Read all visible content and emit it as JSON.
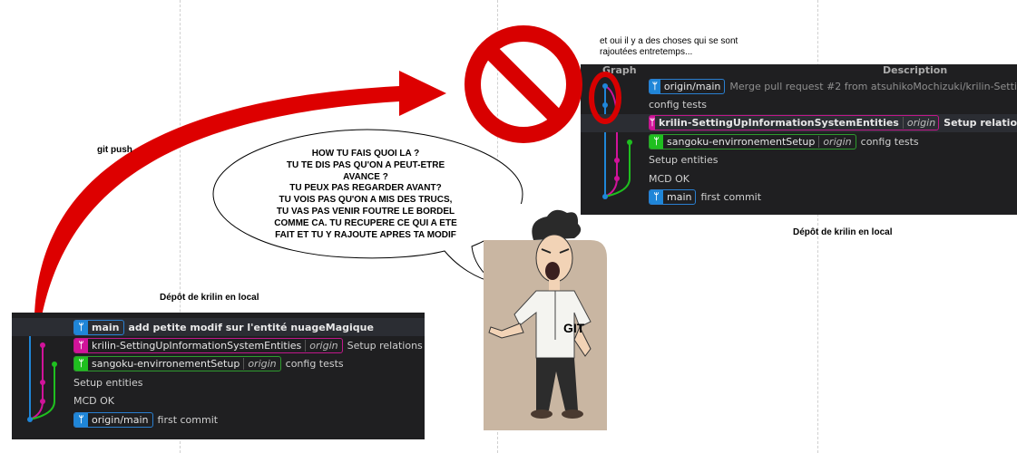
{
  "labels": {
    "git_push": "git push",
    "local_repo_left": "Dépôt de krilin en local",
    "local_repo_right": "Dépôt de krilin en local",
    "note_line1": "et oui il y a des choses qui se sont",
    "note_line2": "rajoutées entretemps...",
    "character": "GIT"
  },
  "speech": [
    "HOW TU FAIS QUOI LA ?",
    "TU TE DIS PAS QU'ON A PEUT-ETRE",
    "AVANCE ?",
    "TU PEUX PAS REGARDER AVANT?",
    "TU VOIS PAS QU'ON A MIS DES TRUCS,",
    "TU VAS PAS VENIR FOUTRE LE BORDEL",
    "COMME CA. TU RECUPERE CE QUI A ETE",
    "FAIT ET TU Y RAJOUTE APRES TA MODIF"
  ],
  "left_panel": {
    "rows": [
      {
        "badge": "main",
        "color": "blue",
        "origin": "",
        "message": "add petite modif sur l'entité nuageMagique",
        "bold": true
      },
      {
        "badge": "krilin-SettingUpInformationSystemEntities",
        "color": "pink",
        "origin": "origin",
        "message": "Setup relations",
        "bold": false
      },
      {
        "badge": "sangoku-envirronementSetup",
        "color": "green",
        "origin": "origin",
        "message": "config tests",
        "bold": false
      },
      {
        "badge": "",
        "color": "",
        "origin": "",
        "message": "Setup entities",
        "bold": false
      },
      {
        "badge": "",
        "color": "",
        "origin": "",
        "message": "MCD OK",
        "bold": false
      },
      {
        "badge": "origin/main",
        "color": "blue",
        "origin": "",
        "message": "first commit",
        "bold": false
      }
    ]
  },
  "right_panel": {
    "header_graph": "Graph",
    "header_description": "Description",
    "rows": [
      {
        "badge": "origin/main",
        "color": "blue",
        "origin": "",
        "message": "Merge pull request #2 from atsuhikoMochizuki/krilin-Setti",
        "bold": false,
        "grey": true
      },
      {
        "badge": "",
        "color": "",
        "origin": "",
        "message": "config tests",
        "bold": false,
        "grey": false
      },
      {
        "badge": "krilin-SettingUpInformationSystemEntities",
        "color": "pink",
        "origin": "origin",
        "message": "Setup relatio",
        "bold": true,
        "grey": false
      },
      {
        "badge": "sangoku-envirronementSetup",
        "color": "green",
        "origin": "origin",
        "message": "config tests",
        "bold": false,
        "grey": false
      },
      {
        "badge": "",
        "color": "",
        "origin": "",
        "message": "Setup entities",
        "bold": false,
        "grey": false
      },
      {
        "badge": "",
        "color": "",
        "origin": "",
        "message": "MCD OK",
        "bold": false,
        "grey": false
      },
      {
        "badge": "main",
        "color": "blue",
        "origin": "",
        "message": "first commit",
        "bold": false,
        "grey": false
      }
    ]
  },
  "colors": {
    "blue": "#1f86d8",
    "pink": "#d1139a",
    "green": "#1fbf1f",
    "arrow": "#dd0000",
    "stop": "#d80000"
  }
}
